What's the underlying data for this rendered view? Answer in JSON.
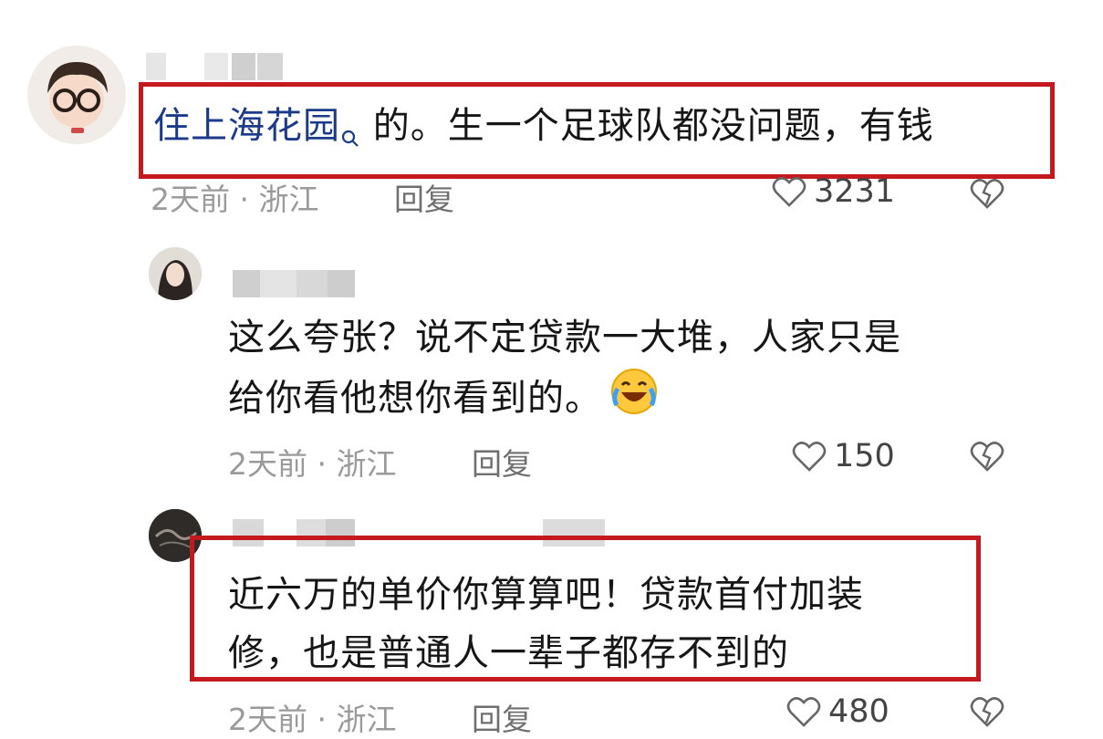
{
  "comments": [
    {
      "text_lines": [
        "住上海花园",
        "的。生一个足球队都没问题，有钱"
      ],
      "search_icon": "search-icon",
      "time_location": "2天前 · 浙江",
      "reply_label": "回复",
      "likes": "3231",
      "highlighted": true
    },
    {
      "text_lines": [
        "这么夸张？说不定贷款一大堆，人家只是",
        "给你看他想你看到的。"
      ],
      "emoji": "laughing-crying-emoji",
      "time_location": "2天前 · 浙江",
      "reply_label": "回复",
      "likes": "150",
      "highlighted": false
    },
    {
      "text_lines": [
        "近六万的单价你算算吧！贷款首付加装",
        "修，也是普通人一辈子都存不到的"
      ],
      "time_location": "2天前 · 浙江",
      "reply_label": "回复",
      "likes": "480",
      "highlighted": true
    }
  ],
  "icons": {
    "like": "heart-outline-icon",
    "dislike": "broken-heart-icon"
  },
  "colors": {
    "highlight_border": "#c41a1f",
    "meta_text": "#9a9a9a"
  }
}
